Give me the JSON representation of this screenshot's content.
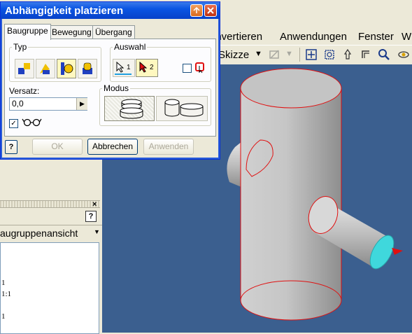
{
  "dialog": {
    "title": "Abhängigkeit platzieren",
    "tabs": [
      {
        "label": "Baugruppe",
        "active": true
      },
      {
        "label": "Bewegung",
        "active": false
      },
      {
        "label": "Übergang",
        "active": false
      }
    ],
    "typ_label": "Typ",
    "auswahl_label": "Auswahl",
    "selection_1": "1",
    "selection_2": "2",
    "versatz_label": "Versatz:",
    "versatz_value": "0,0",
    "modus_label": "Modus",
    "show_preview_checked": true,
    "buttons": {
      "ok": "OK",
      "cancel": "Abbrechen",
      "apply": "Anwenden"
    }
  },
  "app": {
    "menu": [
      "onvertieren",
      "Anwendungen",
      "Fenster",
      "W"
    ],
    "sketch_label": "Skizze",
    "browser_title": "augruppenansicht",
    "panel_lines": [
      "1",
      "1:1",
      "1"
    ],
    "help_glyph": "?",
    "close_glyph": "×"
  },
  "colors": {
    "viewport_bg": "#3b5f8f",
    "title_bar": "#0a55e3",
    "highlight_edge": "#e01010",
    "selected_face": "#3fd8dc"
  }
}
